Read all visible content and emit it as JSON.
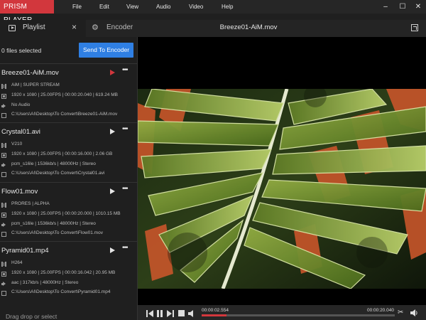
{
  "app": {
    "logo": "PRISM PLAYER",
    "menu": [
      "File",
      "Edit",
      "View",
      "Audio",
      "Video",
      "Help"
    ]
  },
  "tabs": {
    "playlist": "Playlist",
    "encoder": "Encoder"
  },
  "video_title": "Breeze01-AiM.mov",
  "sidebar": {
    "files_selected": "0 files selected",
    "send_button": "Send To Encoder",
    "drag_hint": "Drag drop or select",
    "items": [
      {
        "name": "Breeze01-AiM.mov",
        "playing": true,
        "codec": "AiM | SUPER STREAM",
        "video": "1920 x 1080 | 25.00FPS | 00:00:20.040 | 619.24 MB",
        "audio": "No Audio",
        "path": "C:\\Users\\AI\\Desktop\\To Convert\\Breeze01-AiM.mov"
      },
      {
        "name": "Crystal01.avi",
        "playing": false,
        "codec": "V210",
        "video": "1920 x 1080 | 25.00FPS | 00:00:16.000 | 2.06 GB",
        "audio": "pcm_s16le | 1536kb/s | 48000Hz | Stereo",
        "path": "C:\\Users\\AI\\Desktop\\To Convert\\Crystal01.avi"
      },
      {
        "name": "Flow01.mov",
        "playing": false,
        "codec": "PRORES | ALPHA",
        "video": "1920 x 1080 | 25.00FPS | 00:00:20.000 | 1010.15 MB",
        "audio": "pcm_s16le | 1536kb/s | 48000Hz | Stereo",
        "path": "C:\\Users\\AI\\Desktop\\To Convert\\Flow01.mov"
      },
      {
        "name": "Pyramid01.mp4",
        "playing": false,
        "codec": "H264",
        "video": "1920 x 1080 | 25.00FPS | 00:00:16.042 | 20.95 MB",
        "audio": "aac | 317kb/s | 48000Hz | Stereo",
        "path": "C:\\Users\\AI\\Desktop\\To Convert\\Pyramid01.mp4"
      }
    ]
  },
  "playback": {
    "current_time": "00:00:02.554",
    "total_time": "00:00:20.040",
    "progress": 0.1274
  },
  "colors": {
    "accent_red": "#d2373d",
    "button_blue": "#2f7fe3"
  },
  "icons": {
    "video_row": "film-icon",
    "codec_row": "bars-icon",
    "audio_row": "speaker-icon",
    "path_row": "file-icon"
  }
}
